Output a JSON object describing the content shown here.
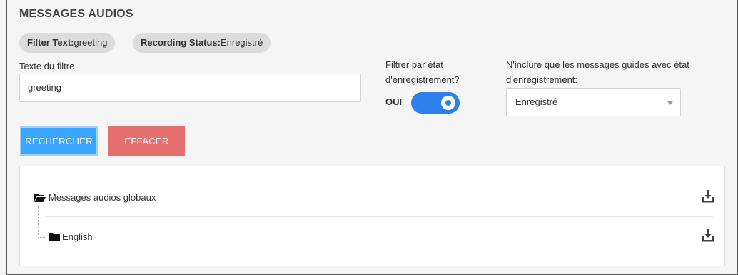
{
  "header": {
    "title": "MESSAGES AUDIOS"
  },
  "filters": {
    "chips": [
      {
        "key": "Filter Text:",
        "value": "greeting"
      },
      {
        "key": "Recording Status:",
        "value": "Enregistré"
      }
    ],
    "text_filter": {
      "label": "Texte du filtre",
      "value": "greeting"
    },
    "status_toggle": {
      "label_line1": "Filtrer par état",
      "label_line2": "d'enregistrement?",
      "state_label": "OUI",
      "on": true
    },
    "status_select": {
      "label_line1": "N'inclure que les messages guides avec état",
      "label_line2": "d'enregistrement:",
      "value": "Enregistré"
    },
    "search_button": "RECHERCHER",
    "clear_button": "EFFACER"
  },
  "tree": {
    "root": {
      "label": "Messages audios globaux",
      "icon": "folder-open-icon",
      "download_icon": "download-icon"
    },
    "children": [
      {
        "label": "English",
        "icon": "folder-icon",
        "download_icon": "download-icon"
      }
    ]
  },
  "colors": {
    "primary": "#3aa6ff",
    "danger": "#e36f6f",
    "toggle": "#2f80ed",
    "chip": "#dcdcdc"
  }
}
